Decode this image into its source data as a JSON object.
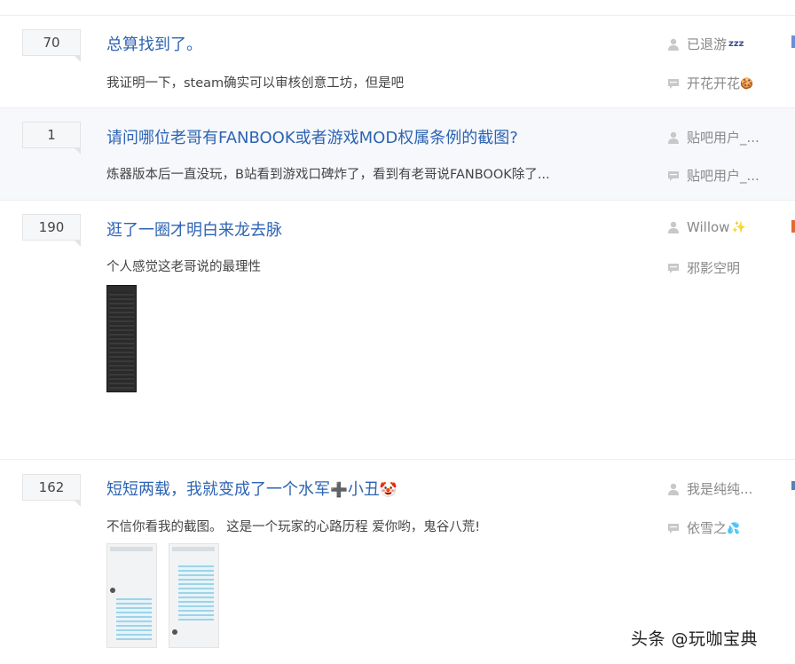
{
  "threads": [
    {
      "reply_count": "70",
      "title": "总算找到了。",
      "abstract": "我证明一下，steam确实可以审核创意工坊，但是吧",
      "author": "已退游",
      "author_suffix": "zzz",
      "last_reply": "开花开花",
      "last_reply_suffix": "🍪"
    },
    {
      "reply_count": "1",
      "title": "请问哪位老哥有FANBOOK或者游戏MOD权属条例的截图?",
      "abstract": "炼器版本后一直没玩，B站看到游戏口碑炸了，看到有老哥说FANBOOK除了...",
      "author": "贴吧用户_...",
      "last_reply": "贴吧用户_..."
    },
    {
      "reply_count": "190",
      "title": "逛了一圈才明白来龙去脉",
      "abstract": "个人感觉这老哥说的最理性",
      "author": "Willow",
      "author_suffix": "✨",
      "last_reply": "邪影空明"
    },
    {
      "reply_count": "162",
      "title": "短短两载，我就变成了一个水军",
      "title_plus": "➕",
      "title_tail": "小丑",
      "title_emoji": "🤡",
      "abstract": "不信你看我的截图。 这是一个玩家的心路历程 爱你哟，鬼谷八荒!",
      "author": "我是纯纯...",
      "last_reply": "依雪之",
      "last_reply_suffix": "💦"
    }
  ],
  "icons": {
    "user": "user-icon",
    "reply": "reply-bubble-icon"
  },
  "colors": {
    "title_link": "#2d64b3",
    "alt_row": "#f6f8fb",
    "meta_text": "#888888"
  },
  "watermark": "头条 @玩咖宝典"
}
